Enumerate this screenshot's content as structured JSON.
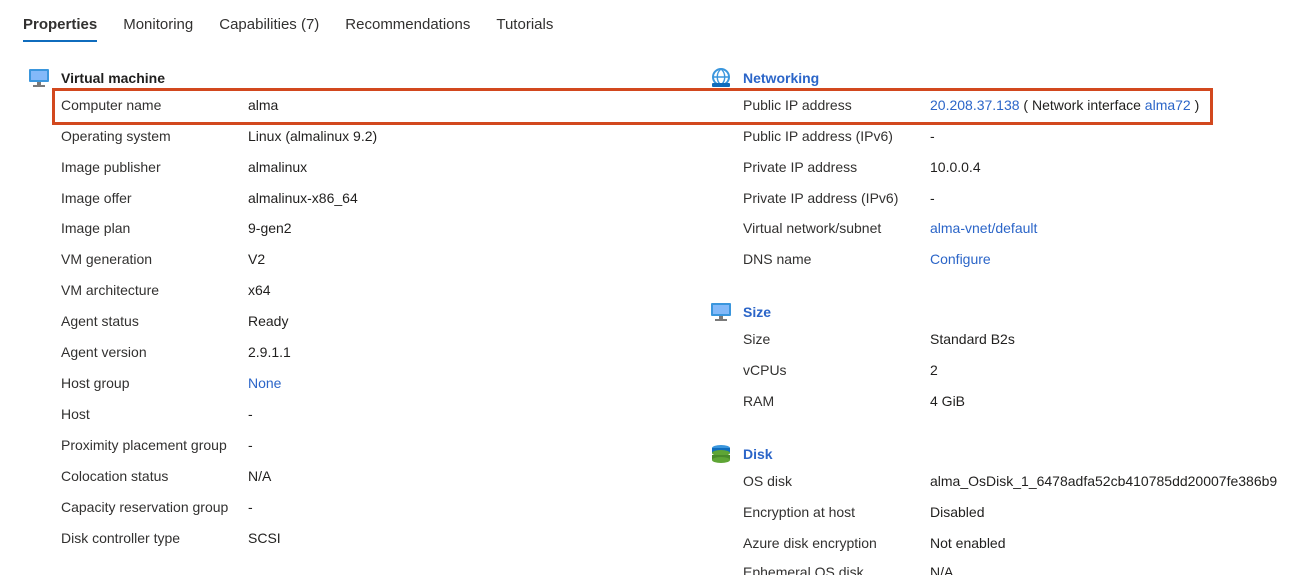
{
  "tabs": [
    {
      "label": "Properties"
    },
    {
      "label": "Monitoring"
    },
    {
      "label": "Capabilities (7)"
    },
    {
      "label": "Recommendations"
    },
    {
      "label": "Tutorials"
    }
  ],
  "vm": {
    "title": "Virtual machine",
    "rows": [
      {
        "label": "Computer name",
        "value": "alma"
      },
      {
        "label": "Operating system",
        "value": "Linux (almalinux 9.2)"
      },
      {
        "label": "Image publisher",
        "value": "almalinux"
      },
      {
        "label": "Image offer",
        "value": "almalinux-x86_64"
      },
      {
        "label": "Image plan",
        "value": "9-gen2"
      },
      {
        "label": "VM generation",
        "value": "V2"
      },
      {
        "label": "VM architecture",
        "value": "x64"
      },
      {
        "label": "Agent status",
        "value": "Ready"
      },
      {
        "label": "Agent version",
        "value": "2.9.1.1"
      },
      {
        "label": "Host group",
        "value": "None"
      },
      {
        "label": "Host",
        "value": "-"
      },
      {
        "label": "Proximity placement group",
        "value": "-"
      },
      {
        "label": "Colocation status",
        "value": "N/A"
      },
      {
        "label": "Capacity reservation group",
        "value": "-"
      },
      {
        "label": "Disk controller type",
        "value": "SCSI"
      }
    ]
  },
  "networking": {
    "title": "Networking",
    "public_ip": {
      "label": "Public IP address",
      "ip": "20.208.37.138",
      "nic_prefix": "( Network interface",
      "nic": "alma72",
      "nic_suffix": ")"
    },
    "rows": [
      {
        "label": "Public IP address (IPv6)",
        "value": "-"
      },
      {
        "label": "Private IP address",
        "value": "10.0.0.4"
      },
      {
        "label": "Private IP address (IPv6)",
        "value": "-"
      },
      {
        "label": "Virtual network/subnet",
        "value": "alma-vnet/default"
      },
      {
        "label": "DNS name",
        "value": "Configure"
      }
    ]
  },
  "size": {
    "title": "Size",
    "rows": [
      {
        "label": "Size",
        "value": "Standard B2s"
      },
      {
        "label": "vCPUs",
        "value": "2"
      },
      {
        "label": "RAM",
        "value": "4 GiB"
      }
    ]
  },
  "disk": {
    "title": "Disk",
    "rows": [
      {
        "label": "OS disk",
        "value": "alma_OsDisk_1_6478adfa52cb410785dd20007fe386b9"
      },
      {
        "label": "Encryption at host",
        "value": "Disabled"
      },
      {
        "label": "Azure disk encryption",
        "value": "Not enabled"
      },
      {
        "label": "Ephemeral OS disk",
        "value": "N/A"
      }
    ]
  },
  "colors": {
    "link": "#2b65c8",
    "highlight": "#d2481e",
    "tab_underline": "#0f6cbd"
  }
}
